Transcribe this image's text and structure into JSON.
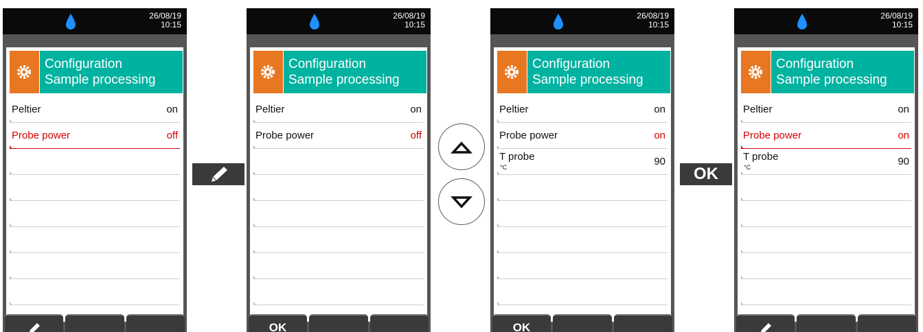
{
  "status": {
    "date": "26/08/19",
    "time": "10:15"
  },
  "header": {
    "line1": "Configuration",
    "line2": "Sample processing"
  },
  "screens": [
    {
      "rows": [
        {
          "name": "Peltier",
          "value": "on"
        },
        {
          "name": "Probe power",
          "value": "off"
        }
      ],
      "softkey1": ""
    },
    {
      "rows": [
        {
          "name": "Peltier",
          "value": "on"
        },
        {
          "name": "Probe power",
          "value": "off"
        }
      ],
      "softkey1": "OK"
    },
    {
      "rows": [
        {
          "name": "Peltier",
          "value": "on"
        },
        {
          "name": "Probe power",
          "value": "on"
        },
        {
          "name": "T probe",
          "unit": "°C",
          "value": "90"
        }
      ],
      "softkey1": "OK"
    },
    {
      "rows": [
        {
          "name": "Peltier",
          "value": "on"
        },
        {
          "name": "Probe power",
          "value": "on"
        },
        {
          "name": "T probe",
          "unit": "°C",
          "value": "90"
        }
      ],
      "softkey1": ""
    }
  ],
  "actions": {
    "ok_label": "OK"
  },
  "icons": {
    "status": "water-drop-icon",
    "header": "gear-icon",
    "edit": "pencil-icon",
    "up": "arrow-up-icon",
    "down": "arrow-down-icon"
  },
  "colors": {
    "accent_teal": "#00b2a0",
    "accent_orange": "#e87722",
    "selected_red": "#d40000",
    "drop_blue": "#1e90ff"
  }
}
